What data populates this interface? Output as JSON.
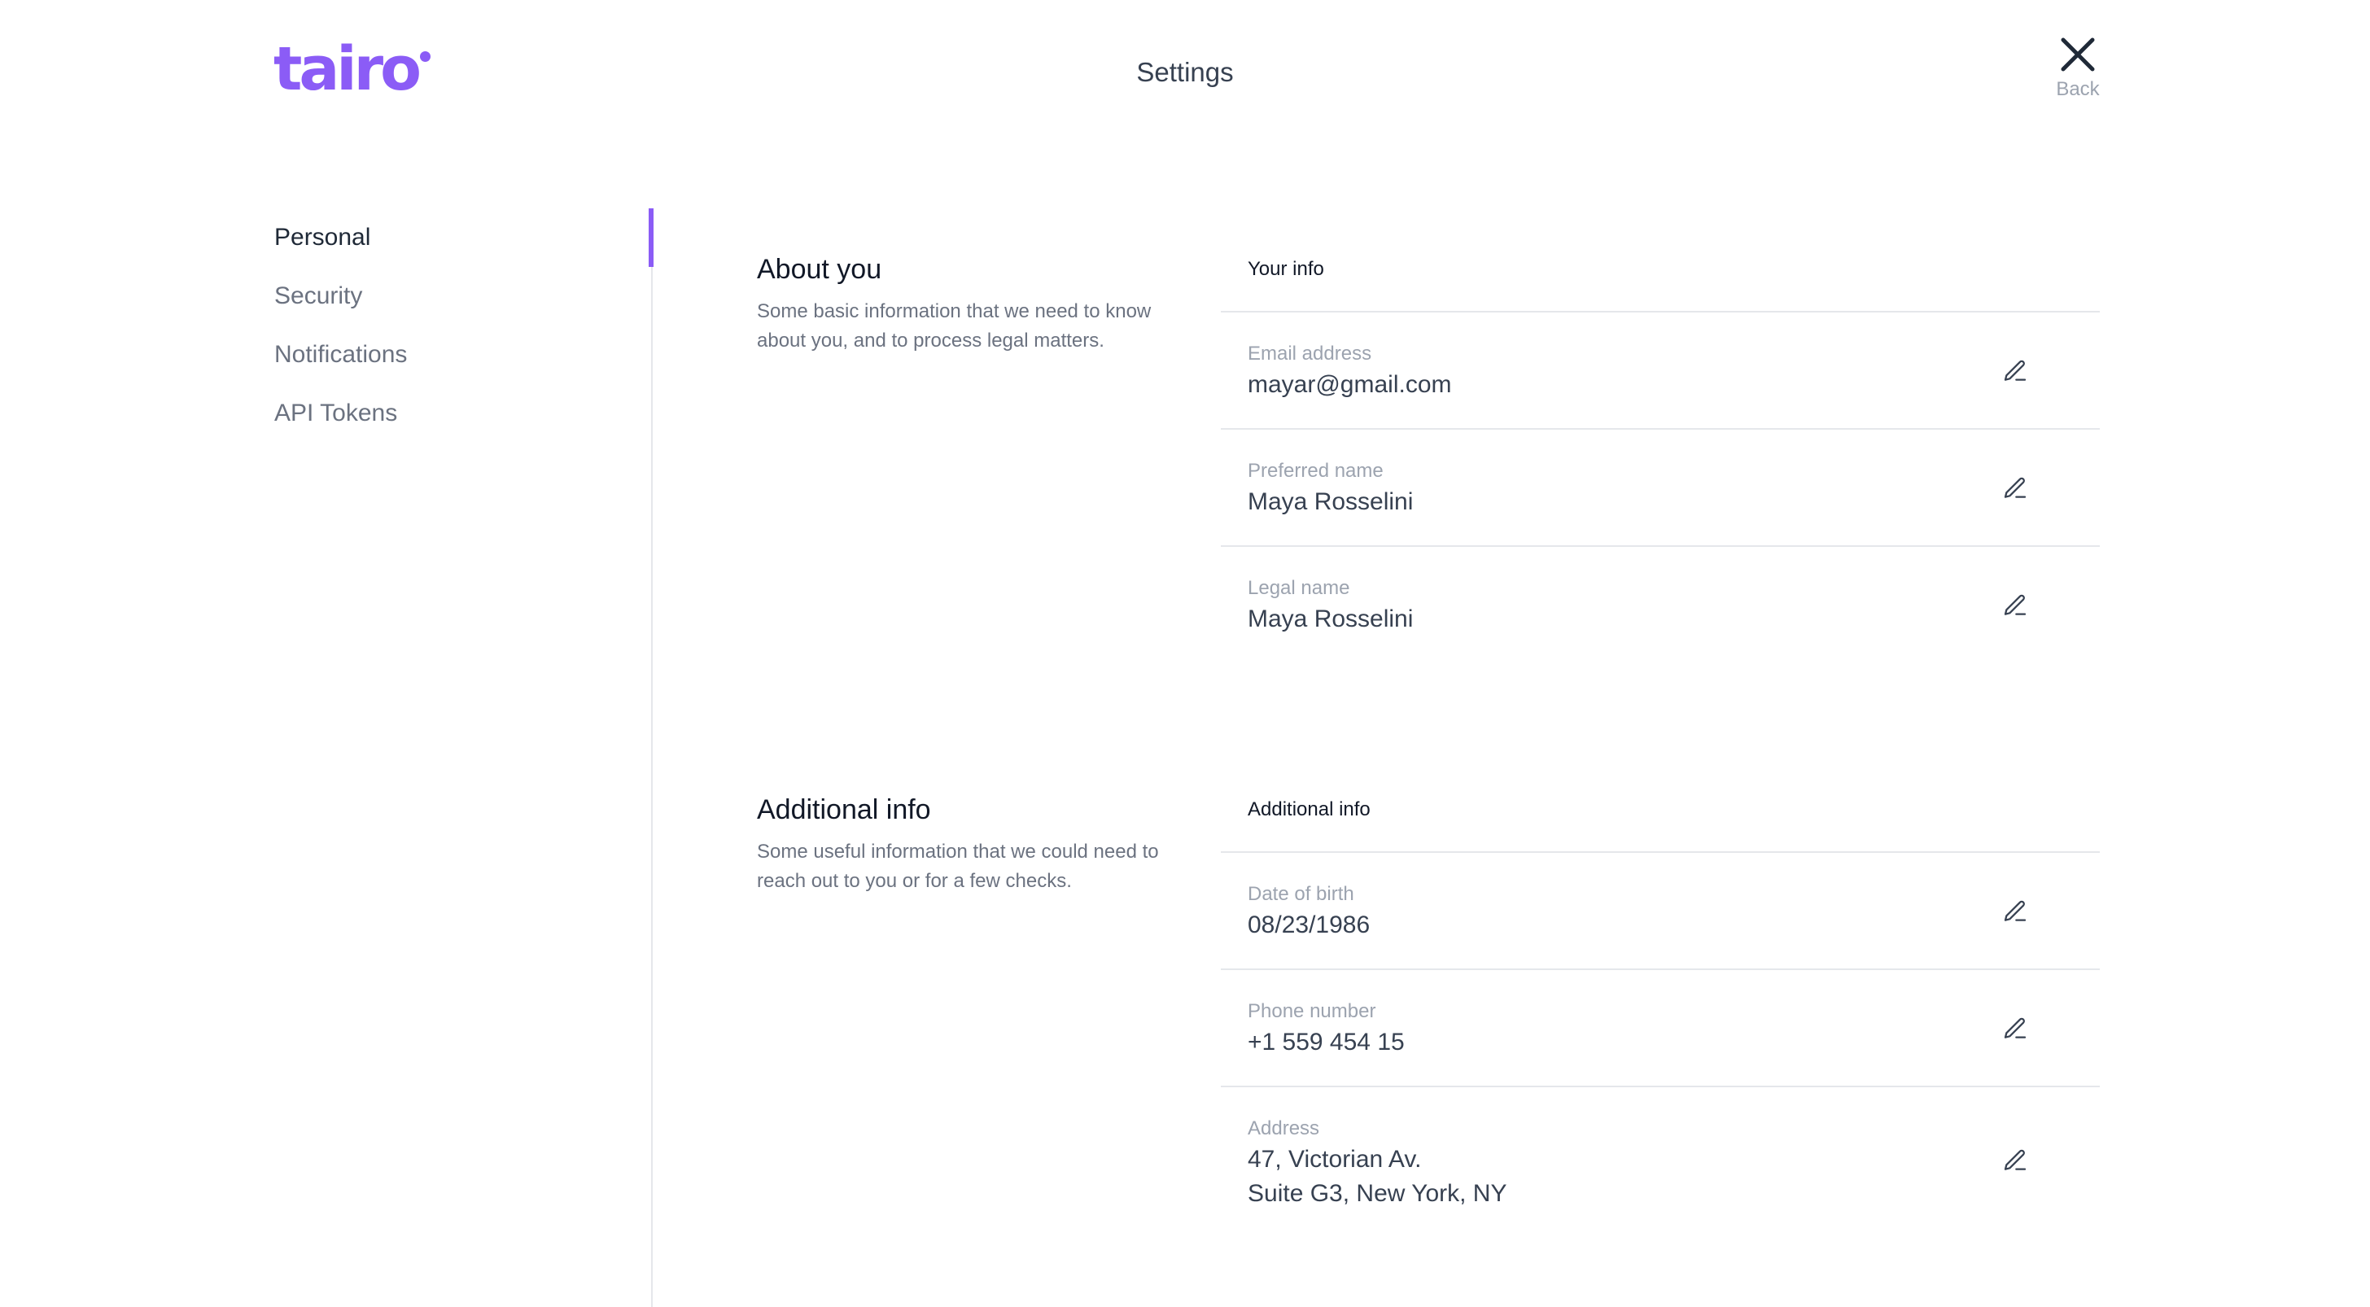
{
  "header": {
    "logo_text": "tairo",
    "title": "Settings",
    "back_label": "Back",
    "back_icon": "close-icon"
  },
  "sidebar": {
    "items": [
      {
        "label": "Personal",
        "active": true
      },
      {
        "label": "Security",
        "active": false
      },
      {
        "label": "Notifications",
        "active": false
      },
      {
        "label": "API Tokens",
        "active": false
      }
    ]
  },
  "about": {
    "title": "About you",
    "description": "Some basic information that we need to know about you, and to process legal matters.",
    "card_title": "Your info",
    "fields": [
      {
        "label": "Email address",
        "value": "mayar@gmail.com",
        "icon": "pencil-icon"
      },
      {
        "label": "Preferred name",
        "value": "Maya Rosselini",
        "icon": "pencil-icon"
      },
      {
        "label": "Legal name",
        "value": "Maya Rosselini",
        "icon": "pencil-icon"
      }
    ]
  },
  "additional": {
    "title": "Additional info",
    "description": "Some useful information that we could need to reach out to you or for a few checks.",
    "card_title": "Additional info",
    "fields": [
      {
        "label": "Date of birth",
        "value": "08/23/1986",
        "icon": "pencil-icon"
      },
      {
        "label": "Phone number",
        "value": "+1 559 454 15",
        "icon": "pencil-icon"
      },
      {
        "label": "Address",
        "value": "47, Victorian Av.",
        "value2": "Suite G3, New York, NY",
        "icon": "pencil-icon"
      }
    ]
  },
  "colors": {
    "accent": "#8b5cf6",
    "text_primary": "#111827",
    "text_muted": "#6b7280",
    "border": "#e5e7eb"
  }
}
